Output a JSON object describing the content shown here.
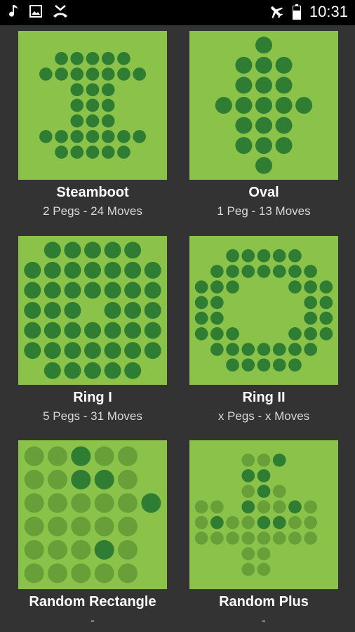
{
  "status_bar": {
    "time": "10:31",
    "icons": [
      "music-note-icon",
      "image-icon",
      "missed-call-icon",
      "airplane-icon",
      "battery-icon"
    ]
  },
  "colors": {
    "board": "#8bc34a",
    "peg_dark": "#2e7d32",
    "peg_light": "#689f38",
    "background": "#333333"
  },
  "puzzles": [
    {
      "name": "Steamboot",
      "info": "2 Pegs - 24 Moves",
      "board": [
        "..XXXXX..",
        ".XXXXXXX.",
        "...XXX...",
        "...XXX...",
        "...XXX...",
        ".XXXXXXX.",
        "..XXXXX.."
      ]
    },
    {
      "name": "Oval",
      "info": "1 Peg - 13 Moves",
      "board": [
        "...X...",
        "..XXX..",
        "..XXX..",
        ".XXXXX.",
        "..XXX..",
        "..XXX..",
        "...X..."
      ]
    },
    {
      "name": "Ring I",
      "info": "5 Pegs - 31 Moves",
      "board": [
        ".XXXXX.",
        "XXXXXXX",
        "XXXXXXX",
        "XXX.XXX",
        "XXXXXXX",
        "XXXXXXX",
        ".XXXXX."
      ]
    },
    {
      "name": "Ring II",
      "info": "x Pegs - x Moves",
      "board": [
        "..XXXXX..",
        ".XXXXXXX.",
        "XXX...XXX",
        "XX.....XX",
        "XX.....XX",
        "XXX...XXX",
        ".XXXXXXX.",
        "..XXXXX.."
      ]
    },
    {
      "name": "Random Rectangle",
      "info": "-",
      "board": [
        "oo#oo",
        "oo##o",
        "ooooo#",
        "ooooo",
        "ooo#o",
        "ooooo"
      ]
    },
    {
      "name": "Random Plus",
      "info": "-",
      "board": [
        "...oo#...",
        "...##....",
        "...o#o...",
        "oo.#oo#o.",
        "o#oo##oo.",
        "oooooooo.",
        "...oo....",
        "...oo...."
      ]
    }
  ]
}
